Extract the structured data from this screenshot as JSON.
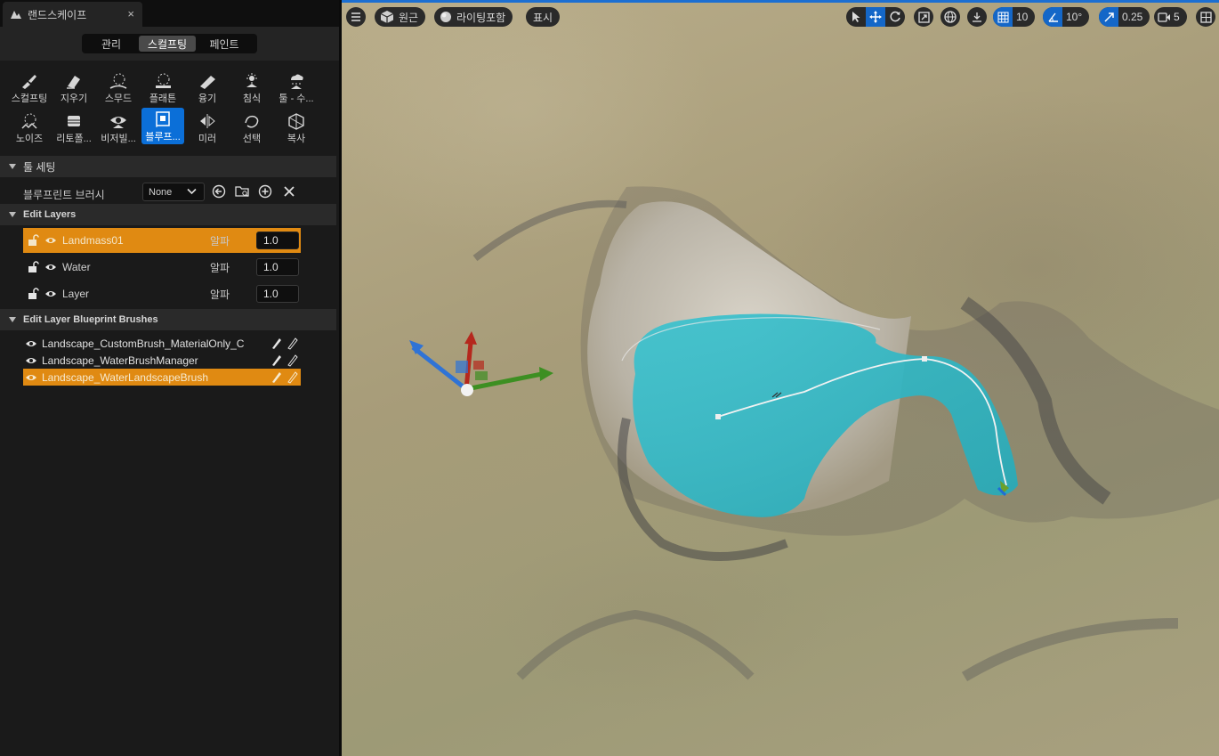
{
  "tab": {
    "title": "랜드스케이프",
    "close": "×"
  },
  "modes": [
    "관리",
    "스컬프팅",
    "페인트"
  ],
  "active_mode": "스컬프팅",
  "tools": [
    {
      "label": "스컬프팅",
      "icon": "sculpt-brush-icon"
    },
    {
      "label": "지우기",
      "icon": "erase-icon"
    },
    {
      "label": "스무드",
      "icon": "smooth-icon"
    },
    {
      "label": "플래튼",
      "icon": "flatten-icon"
    },
    {
      "label": "융기",
      "icon": "ramp-icon"
    },
    {
      "label": "침식",
      "icon": "erosion-icon"
    },
    {
      "label": "툴 - 수...",
      "icon": "hydro-erosion-icon"
    },
    {
      "label": "노이즈",
      "icon": "noise-icon"
    },
    {
      "label": "리토폴...",
      "icon": "retopologize-icon"
    },
    {
      "label": "비저빌...",
      "icon": "visibility-icon"
    },
    {
      "label": "블루프...",
      "icon": "blueprint-icon",
      "active": true
    },
    {
      "label": "미러",
      "icon": "mirror-icon"
    },
    {
      "label": "선택",
      "icon": "select-icon"
    },
    {
      "label": "복사",
      "icon": "copy-icon"
    }
  ],
  "tool_settings": {
    "header": "툴 세팅",
    "blueprint_brush_label": "블루프린트 브러시",
    "blueprint_brush_value": "None"
  },
  "edit_layers": {
    "header": "Edit Layers",
    "alpha_label": "알파",
    "layers": [
      {
        "name": "Landmass01",
        "alpha": "1.0",
        "selected": true
      },
      {
        "name": "Water",
        "alpha": "1.0",
        "selected": false
      },
      {
        "name": "Layer",
        "alpha": "1.0",
        "selected": false
      }
    ]
  },
  "blueprint_brushes": {
    "header": "Edit Layer Blueprint Brushes",
    "items": [
      {
        "name": "Landscape_CustomBrush_MaterialOnly_C",
        "selected": false
      },
      {
        "name": "Landscape_WaterBrushManager",
        "selected": false
      },
      {
        "name": "Landscape_WaterLandscapeBrush",
        "selected": true
      }
    ]
  },
  "viewport": {
    "view_mode": "원근",
    "lighting": "라이팅포함",
    "show": "표시",
    "grid_snap": "10",
    "rot_snap": "10°",
    "scale_snap": "0.25",
    "camera_speed": "5"
  }
}
